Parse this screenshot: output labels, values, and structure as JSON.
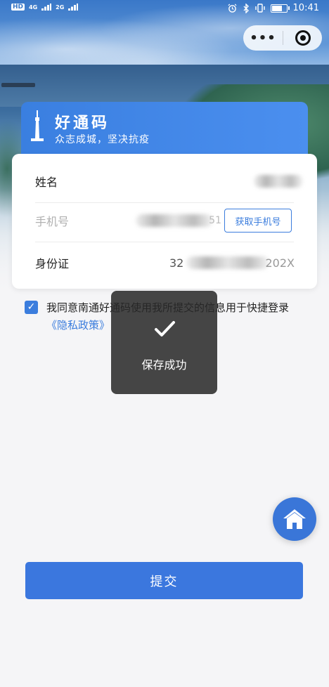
{
  "status_bar": {
    "network_left": "HD",
    "signal_1": "4G",
    "signal_2": "2G",
    "time": "10:41",
    "battery_level": 0.8
  },
  "capsule": {
    "more_icon": "more-dots-icon",
    "close_icon": "target-circle-icon"
  },
  "banner": {
    "title": "好通码",
    "subtitle": "众志成城，坚决抗疫"
  },
  "form": {
    "name_label": "姓名",
    "phone_label": "手机号",
    "phone_partial": "51",
    "get_phone_button": "获取手机号",
    "id_label": "身份证",
    "id_prefix": "32",
    "id_suffix": "202X"
  },
  "agreement": {
    "checked": true,
    "text": "我同意南通好通码使用我所提交的信息用于快捷登录",
    "link": "《隐私政策》"
  },
  "toast": {
    "message": "保存成功"
  },
  "home_button": {
    "icon": "home-icon"
  },
  "submit_label": "提交",
  "colors": {
    "accent": "#3b77de",
    "toast_bg": "#2a2a2a"
  }
}
